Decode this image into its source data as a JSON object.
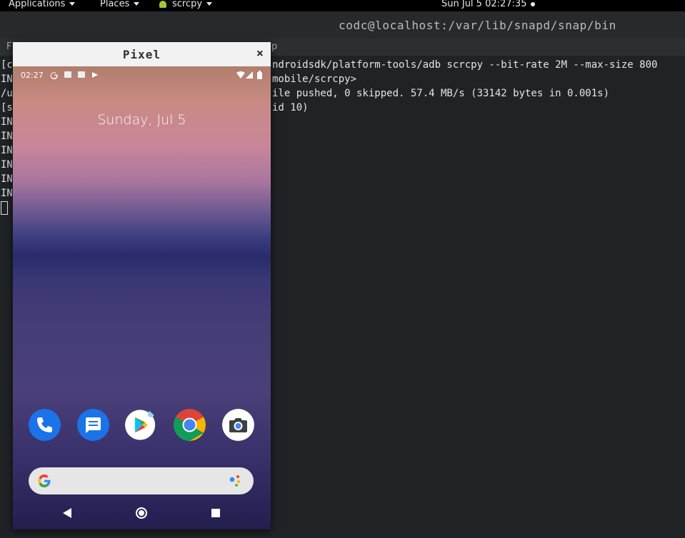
{
  "topbar": {
    "applications": "Applications",
    "places": "Places",
    "app_name": "scrcpy",
    "clock": "Sun Jul 5  02:27:35"
  },
  "terminal": {
    "title": "codc@localhost:/var/lib/snapd/snap/bin",
    "menu_left": "F",
    "menu_right": "p",
    "left_fragments": [
      "[c",
      "IN",
      "/u",
      "[s",
      "IN",
      "IN",
      "IN",
      "IN",
      "IN",
      "IN"
    ],
    "right_fragments": [
      "ndroidsdk/platform-tools/adb scrcpy --bit-rate 2M --max-size 800",
      "mobile/scrcpy>",
      "ile pushed, 0 skipped. 57.4 MB/s (33142 bytes in 0.001s)",
      "id 10)"
    ]
  },
  "pixel_window": {
    "title": "Pixel",
    "close": "×",
    "status_time": "02:27",
    "status_icons": [
      "google-icon",
      "calendar-icon",
      "gmail-icon",
      "play-icon",
      "wifi-icon",
      "signal-icon",
      "battery-icon"
    ],
    "date": "Sunday, Jul 5",
    "dock_apps": [
      "phone",
      "messages",
      "play-store",
      "chrome",
      "camera"
    ],
    "colors": {
      "phone": "#1a73e8",
      "messages": "#1a73e8",
      "chrome_red": "#db4437",
      "chrome_yellow": "#f4b400",
      "chrome_green": "#0f9d58"
    }
  }
}
